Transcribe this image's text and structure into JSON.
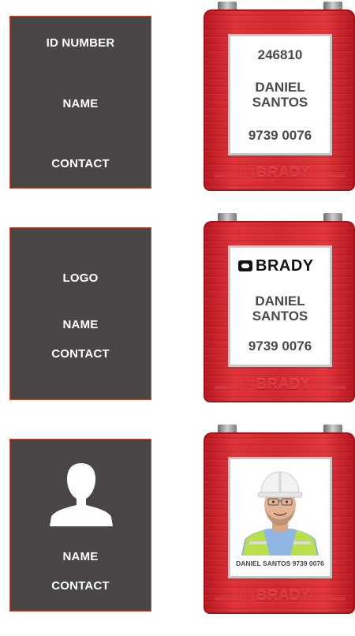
{
  "rows": [
    {
      "card": {
        "field1": "ID NUMBER",
        "field2": "NAME",
        "field3": "CONTACT"
      },
      "label": {
        "id_number": "246810",
        "name_line1": "DANIEL",
        "name_line2": "SANTOS",
        "contact": "9739 0076"
      }
    },
    {
      "card": {
        "field1": "LOGO",
        "field2": "NAME",
        "field3": "CONTACT"
      },
      "label": {
        "logo_text": "BRADY",
        "name_line1": "DANIEL",
        "name_line2": "SANTOS",
        "contact": "9739 0076"
      }
    },
    {
      "card": {
        "icon": "person-silhouette-icon",
        "field2": "NAME",
        "field3": "CONTACT"
      },
      "label": {
        "caption": "DANIEL SANTOS 9739 0076"
      }
    }
  ],
  "padlock_brand": "BRADY",
  "colors": {
    "card_bg": "#4a4646",
    "card_border": "#c94a33",
    "padlock_red": "#d42a30"
  }
}
